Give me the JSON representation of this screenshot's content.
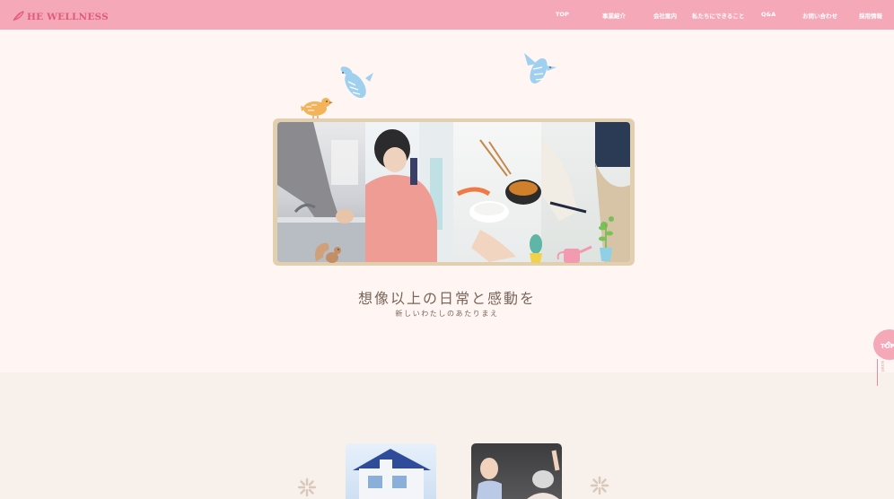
{
  "header": {
    "logo_text": "HE WELLNESS",
    "nav": [
      {
        "label": "TOP"
      },
      {
        "label": "事業紹介"
      },
      {
        "label": "会社案内"
      },
      {
        "label": "私たちにできること"
      },
      {
        "label": "Q&A"
      },
      {
        "label": "お問い合わせ"
      },
      {
        "label": "採用情報"
      }
    ]
  },
  "hero": {
    "tagline_main": "想像以上の日常と感動を",
    "tagline_sub": "新しいわたしのあたりまえ"
  },
  "scroll_top": {
    "label": "TOP",
    "scroll_text": "scroll"
  },
  "colors": {
    "header_bg": "#f5a9b8",
    "logo": "#e05a7a",
    "hero_bg": "#fff6f4",
    "frame": "#e2cfb0",
    "lower_bg": "#f8f0ea"
  },
  "icons": [
    "feather-logo-icon",
    "blue-bird-icon",
    "orange-bird-icon",
    "squirrel-icon",
    "cactus-icon",
    "watering-can-icon",
    "sparkle-icon",
    "chevron-up-icon"
  ]
}
